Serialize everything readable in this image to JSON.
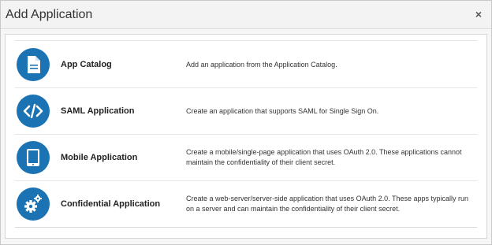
{
  "dialog": {
    "title": "Add Application",
    "close_glyph": "×"
  },
  "applications": [
    {
      "name": "App Catalog",
      "description": "Add an application from the Application Catalog.",
      "icon": "document-icon"
    },
    {
      "name": "SAML Application",
      "description": "Create an application that supports SAML for Single Sign On.",
      "icon": "code-brackets-icon"
    },
    {
      "name": "Mobile Application",
      "description": "Create a mobile/single-page application that uses OAuth 2.0. These applications cannot maintain the confidentiality of their client secret.",
      "icon": "tablet-icon"
    },
    {
      "name": "Confidential Application",
      "description": "Create a web-server/server-side application that uses OAuth 2.0. These apps typically run on a server and can maintain the confidentiality of their client secret.",
      "icon": "gears-icon"
    }
  ],
  "colors": {
    "icon_background": "#1b73b3",
    "icon_foreground": "#ffffff"
  }
}
